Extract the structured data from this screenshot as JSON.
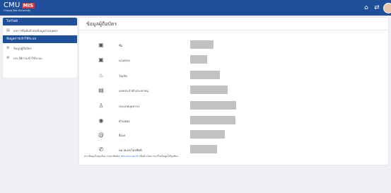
{
  "header": {
    "logo_main": "CMU",
    "logo_badge": "MIS",
    "logo_sub": "Chiang Mai University",
    "icons": [
      "home-icon",
      "swap-icon"
    ]
  },
  "sidebar": {
    "sections": [
      {
        "title": "โปรไฟล์",
        "items": [
          {
            "icon": "document-icon",
            "label": "ผลการยืนยันตัวตนข้อมูลส่วนบุคคล"
          }
        ]
      },
      {
        "title": "ข้อมูลการเข้าใช้ระบบ",
        "items": [
          {
            "icon": "gear-icon",
            "label": "ข้อมูลผู้ถือบัตร"
          },
          {
            "icon": "gear-icon",
            "label": "ประวัติการเข้าใช้ระบบ"
          }
        ]
      }
    ]
  },
  "main": {
    "title": "ข้อมูลผู้ถือบัตร",
    "rows": [
      {
        "icon": "id-card-icon",
        "label": "ชื่อ",
        "value": ""
      },
      {
        "icon": "id-card-icon",
        "label": "นามสกุล",
        "value": ""
      },
      {
        "icon": "cake-icon",
        "label": "วันเกิด",
        "value": ""
      },
      {
        "icon": "id-badge-icon",
        "label": "เลขประจำตัวประชาชน",
        "value": ""
      },
      {
        "icon": "person-icon",
        "label": "ประเภทบุคลากร",
        "value": ""
      },
      {
        "icon": "user-circle-icon",
        "label": "ตำแหน่ง",
        "value": ""
      },
      {
        "icon": "at-icon",
        "label": "อีเมล",
        "value": ""
      },
      {
        "icon": "phone-icon",
        "label": "หมายเลขโทรศัพท์",
        "value": ""
      }
    ],
    "footnote_prefix": "หากข้อมูลไม่ถูกต้อง กรุณาติดต่อ",
    "footnote_link": "mis.cmu.ac.th",
    "footnote_suffix": "เพื่อดำเนินการแก้ไขข้อมูลให้ถูกต้อง"
  },
  "colors": {
    "brand": "#1f4e9a",
    "badge": "#d8343b",
    "redacted": "#c2c2c2"
  }
}
